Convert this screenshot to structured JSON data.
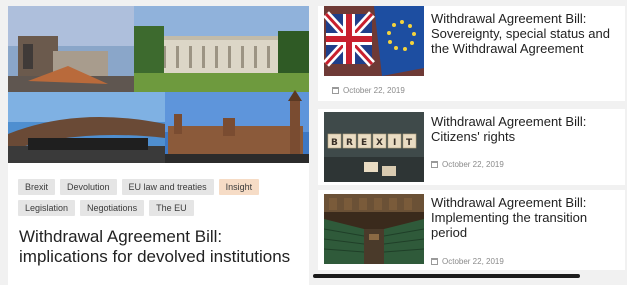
{
  "featured": {
    "tags_row1": [
      "Brexit",
      "Devolution",
      "EU law and treaties",
      "Insight"
    ],
    "tags_row2": [
      "Legislation",
      "Negotiations",
      "The EU"
    ],
    "title": "Withdrawal Agreement Bill: implications for devolved institutions"
  },
  "articles": [
    {
      "title": "Withdrawal Agreement Bill: Sovereignty, special status and the Withdrawal Agreement",
      "date": "October 22, 2019",
      "image": "uk-eu-flags"
    },
    {
      "title": "Withdrawal Agreement Bill: Citizens' rights",
      "date": "October 22, 2019",
      "image": "brexit-scrabble-tiles"
    },
    {
      "title": "Withdrawal Agreement Bill: Implementing the transition period",
      "date": "October 22, 2019",
      "image": "commons-chamber"
    }
  ],
  "colors": {
    "tag_bg": "#e5e5e5",
    "tag_highlight": "#f6dcc6",
    "date_text": "#8a8a8a"
  },
  "icons": [
    "calendar-icon"
  ]
}
